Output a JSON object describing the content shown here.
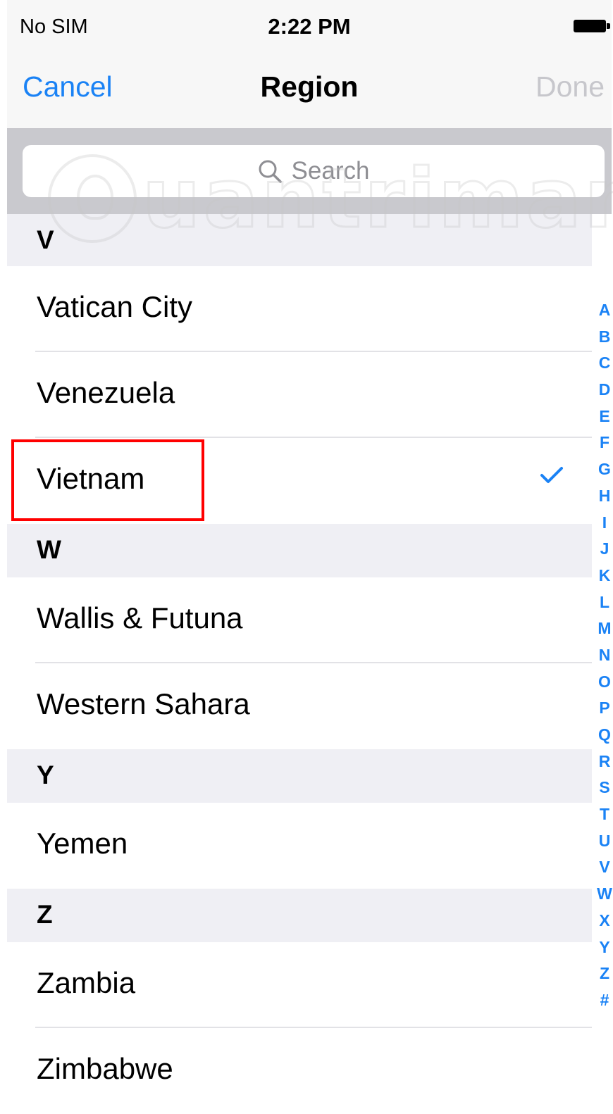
{
  "status_bar": {
    "carrier": "No SIM",
    "time": "2:22 PM",
    "battery_icon": "battery-full-icon"
  },
  "nav": {
    "cancel": "Cancel",
    "title": "Region",
    "done": "Done"
  },
  "search": {
    "placeholder": "Search",
    "icon": "search-icon"
  },
  "watermark": {
    "text": "uantrimang"
  },
  "sections": [
    {
      "letter": "V",
      "items": [
        "Vatican City",
        "Venezuela",
        "Vietnam"
      ]
    },
    {
      "letter": "W",
      "items": [
        "Wallis & Futuna",
        "Western Sahara"
      ]
    },
    {
      "letter": "Y",
      "items": [
        "Yemen"
      ]
    },
    {
      "letter": "Z",
      "items": [
        "Zambia",
        "Zimbabwe"
      ]
    }
  ],
  "selected": "Vietnam",
  "index_letters": [
    "A",
    "B",
    "C",
    "D",
    "E",
    "F",
    "G",
    "H",
    "I",
    "J",
    "K",
    "L",
    "M",
    "N",
    "O",
    "P",
    "Q",
    "R",
    "S",
    "T",
    "U",
    "V",
    "W",
    "X",
    "Y",
    "Z",
    "#"
  ],
  "colors": {
    "accent": "#1a82f5",
    "highlight": "#ff0000",
    "section_bg": "#efeff4",
    "bar_bg": "#f7f7f7",
    "disabled": "#c7c7cc"
  }
}
